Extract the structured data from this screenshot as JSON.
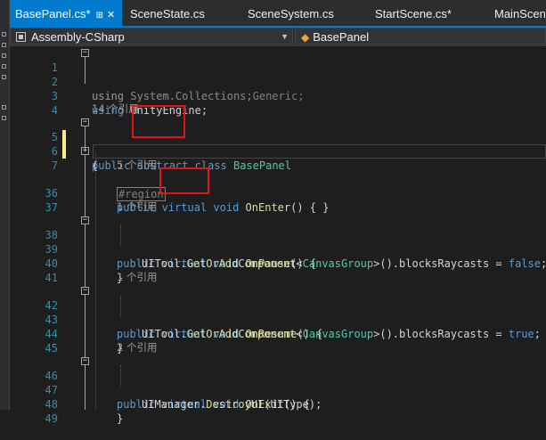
{
  "tabs": [
    {
      "label": "BasePanel.cs*",
      "active": true
    },
    {
      "label": "SceneState.cs"
    },
    {
      "label": "SceneSystem.cs"
    },
    {
      "label": "StartScene.cs*"
    },
    {
      "label": "MainScen"
    }
  ],
  "navbar": {
    "project": "Assembly-CSharp",
    "class": "BasePanel"
  },
  "icons": {
    "pin": "pin-icon",
    "close": "close-icon",
    "dropdown": "chevron-down-icon",
    "project": "csharp-project-icon",
    "class": "class-icon",
    "fold_collapse": "minus-box-icon",
    "fold_expand": "plus-box-icon"
  },
  "colors": {
    "keyword": "#569cd6",
    "type": "#4ec9b0",
    "method": "#dcdcaa",
    "text": "#d4d4d4",
    "line_number": "#2b91af",
    "hint": "#999999",
    "accent": "#007acc",
    "highlight_box": "#e51414"
  },
  "code": {
    "using1": {
      "ln": "1",
      "kw": "using",
      "rest": " System.Collections;"
    },
    "using2": {
      "ln": "2",
      "kw": "using",
      "rest": " System.Collections.Generic;"
    },
    "using3": {
      "ln": "3",
      "kw": "using",
      "rest": " UnityEngine;"
    },
    "ln4": "4",
    "hint_class": "14 个引用",
    "class_decl": {
      "ln": "5",
      "kw1": "public",
      "kw2": "abstract",
      "kw3": "class",
      "name": "BasePanel"
    },
    "brace_open": {
      "ln": "6",
      "text": "{"
    },
    "region": {
      "ln": "7",
      "text": "#region"
    },
    "hint_enter": "5 个引用",
    "enter": {
      "ln": "36",
      "kw1": "public",
      "kw2": "virtual",
      "kw3": "void",
      "name": "OnEnter",
      "rest": "() { }"
    },
    "ln37": "37",
    "hint_pause": "1 个引用",
    "pause": {
      "ln": "38",
      "kw1": "public",
      "kw2": "virtual",
      "kw3": "void",
      "name": "OnPause",
      "rest": "() {"
    },
    "pause_body": {
      "ln": "39",
      "obj": "UITool.",
      "fn": "GetOrAddComponent",
      "lt": "<",
      "ty": "CanvasGroup",
      "gt": ">",
      "mid": "().blocksRaycasts = ",
      "val": "false",
      "end": ";"
    },
    "pause_close": {
      "ln": "40",
      "text": "}"
    },
    "ln41": "41",
    "hint_resume": "1 个引用",
    "resume": {
      "ln": "42",
      "kw1": "public",
      "kw2": "virtual",
      "kw3": "void",
      "name": "OnResume",
      "rest": "() {"
    },
    "resume_body": {
      "ln": "43",
      "obj": "UITool.",
      "fn": "GetOrAddComponent",
      "lt": "<",
      "ty": "CanvasGroup",
      "gt": ">",
      "mid": "().blocksRaycasts = ",
      "val": "true",
      "end": ";"
    },
    "resume_close": {
      "ln": "44",
      "text": "}"
    },
    "ln45": "45",
    "hint_exit": "2 个引用",
    "exit": {
      "ln": "46",
      "kw1": "public",
      "kw2": "virtual",
      "kw3": "void",
      "name": "OnExit",
      "rest": "() {"
    },
    "exit_body": {
      "ln": "47",
      "obj": "UIManager.",
      "fn": "DestroyUI",
      "rest": "(UIType);"
    },
    "exit_close": {
      "ln": "48",
      "text": "}"
    },
    "ln49": "49"
  }
}
